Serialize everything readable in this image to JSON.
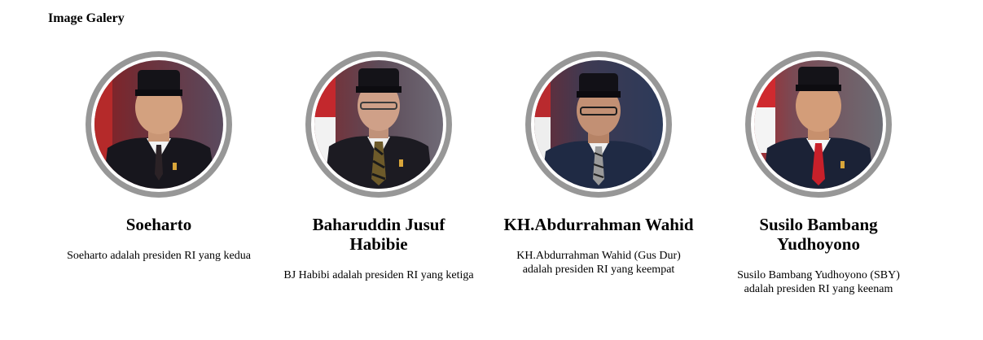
{
  "page": {
    "title": "Image Galery"
  },
  "cards": [
    {
      "name": "Soeharto",
      "desc": "Soeharto adalah presiden RI yang kedua",
      "photo": "portrait-soeharto"
    },
    {
      "name": "Baharuddin Jusuf Habibie",
      "desc": "BJ Habibi adalah presiden RI yang ketiga",
      "photo": "portrait-habibie"
    },
    {
      "name": "KH.Abdurrahman Wahid",
      "desc": "KH.Abdurrahman Wahid (Gus Dur) adalah presiden RI yang keempat",
      "photo": "portrait-abdurrahman-wahid"
    },
    {
      "name": "Susilo Bambang Yudhoyono",
      "desc": "Susilo Bambang Yudhoyono (SBY) adalah presiden RI yang keenam",
      "photo": "portrait-sby"
    }
  ],
  "colors": {
    "ring": "#979797",
    "background": "#ffffff",
    "text": "#000000"
  }
}
